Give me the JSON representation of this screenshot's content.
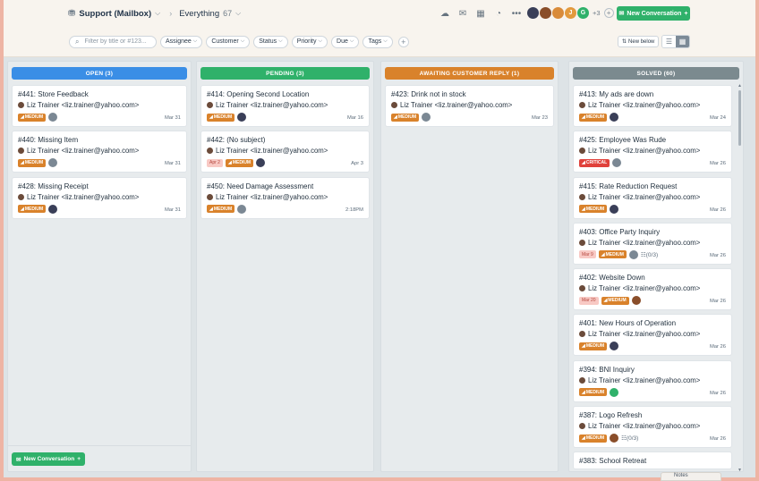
{
  "topbar": {
    "mailbox_label": "Support (Mailbox)",
    "view_label": "Everything",
    "view_count": "67",
    "extra_agents": "+3",
    "new_conversation_label": "New Conversation"
  },
  "agents": [
    {
      "initial": "",
      "color": "#3a3f58"
    },
    {
      "initial": "",
      "color": "#8a4e2a"
    },
    {
      "initial": "",
      "color": "#d98b3a"
    },
    {
      "initial": "J",
      "color": "#e39a3d"
    },
    {
      "initial": "G",
      "color": "#2fb16a"
    }
  ],
  "filters": {
    "search_placeholder": "Filter by title or #123...",
    "pills": [
      "Assignee",
      "Customer",
      "Status",
      "Priority",
      "Due",
      "Tags"
    ],
    "new_below_label": "New below"
  },
  "columns": [
    {
      "title": "OPEN (3)",
      "color": "#3a8ee6",
      "cards": [
        {
          "title": "#441: Store Feedback",
          "from": "Liz Trainer <liz.trainer@yahoo.com>",
          "date_badge": "",
          "priority": "MEDIUM",
          "avatar": "#7b8894",
          "tasks": "",
          "date": "Mar 31"
        },
        {
          "title": "#440: Missing Item",
          "from": "Liz Trainer <liz.trainer@yahoo.com>",
          "date_badge": "",
          "priority": "MEDIUM",
          "avatar": "#7b8894",
          "tasks": "",
          "date": "Mar 31"
        },
        {
          "title": "#428: Missing Receipt",
          "from": "Liz Trainer <liz.trainer@yahoo.com>",
          "date_badge": "",
          "priority": "MEDIUM",
          "avatar": "#3a3f58",
          "tasks": "",
          "date": "Mar 31"
        }
      ],
      "footer_button": "New Conversation"
    },
    {
      "title": "PENDING (3)",
      "color": "#2fb16a",
      "cards": [
        {
          "title": "#414: Opening Second Location",
          "from": "Liz Trainer <liz.trainer@yahoo.com>",
          "date_badge": "",
          "priority": "MEDIUM",
          "avatar": "#3a3f58",
          "tasks": "",
          "date": "Mar 16"
        },
        {
          "title": "#442: (No subject)",
          "from": "Liz Trainer <liz.trainer@yahoo.com>",
          "date_badge": "Apr 2",
          "priority": "MEDIUM",
          "avatar": "#3a3f58",
          "tasks": "",
          "date": "Apr 3"
        },
        {
          "title": "#450: Need Damage Assessment",
          "from": "Liz Trainer <liz.trainer@yahoo.com>",
          "date_badge": "",
          "priority": "MEDIUM",
          "avatar": "#7b8894",
          "tasks": "",
          "date": "2:18PM"
        }
      ],
      "footer_button": ""
    },
    {
      "title": "AWAITING CUSTOMER REPLY (1)",
      "color": "#d9822b",
      "cards": [
        {
          "title": "#423: Drink not in stock",
          "from": "Liz Trainer <liz.trainer@yahoo.com>",
          "date_badge": "",
          "priority": "MEDIUM",
          "avatar": "#7b8894",
          "tasks": "",
          "date": "Mar 23"
        }
      ],
      "footer_button": ""
    },
    {
      "title": "SOLVED (60)",
      "color": "#7b8a8f",
      "cards": [
        {
          "title": "#413: My ads are down",
          "from": "Liz Trainer <liz.trainer@yahoo.com>",
          "date_badge": "",
          "priority": "MEDIUM",
          "avatar": "#3a3f58",
          "tasks": "",
          "date": "Mar 24"
        },
        {
          "title": "#425: Employee Was Rude",
          "from": "Liz Trainer <liz.trainer@yahoo.com>",
          "date_badge": "",
          "priority": "CRITICAL",
          "avatar": "#7b8894",
          "tasks": "",
          "date": "Mar 26"
        },
        {
          "title": "#415: Rate Reduction Request",
          "from": "Liz Trainer <liz.trainer@yahoo.com>",
          "date_badge": "",
          "priority": "MEDIUM",
          "avatar": "#3a3f58",
          "tasks": "",
          "date": "Mar 26"
        },
        {
          "title": "#403: Office Party Inquiry",
          "from": "Liz Trainer <liz.trainer@yahoo.com>",
          "date_badge": "Mar 9",
          "priority": "MEDIUM",
          "avatar": "#7b8894",
          "tasks": "(0/3)",
          "date": "Mar 26"
        },
        {
          "title": "#402: Website Down",
          "from": "Liz Trainer <liz.trainer@yahoo.com>",
          "date_badge": "Mar 20",
          "priority": "MEDIUM",
          "avatar": "#8a4e2a",
          "tasks": "",
          "date": "Mar 26"
        },
        {
          "title": "#401: New Hours of Operation",
          "from": "Liz Trainer <liz.trainer@yahoo.com>",
          "date_badge": "",
          "priority": "MEDIUM",
          "avatar": "#3a3f58",
          "tasks": "",
          "date": "Mar 26"
        },
        {
          "title": "#394: BNI Inquiry",
          "from": "Liz Trainer <liz.trainer@yahoo.com>",
          "date_badge": "",
          "priority": "MEDIUM",
          "avatar": "#2fb16a",
          "tasks": "",
          "date": "Mar 26"
        },
        {
          "title": "#387: Logo Refresh",
          "from": "Liz Trainer <liz.trainer@yahoo.com>",
          "date_badge": "",
          "priority": "MEDIUM",
          "avatar": "#8a4e2a",
          "tasks": "(0/3)",
          "date": "Mar 26"
        },
        {
          "title": "#383: School Retreat",
          "from": "",
          "date_badge": "",
          "priority": "",
          "avatar": "",
          "tasks": "",
          "date": ""
        }
      ],
      "footer_button": ""
    }
  ],
  "notes_label": "Notes"
}
